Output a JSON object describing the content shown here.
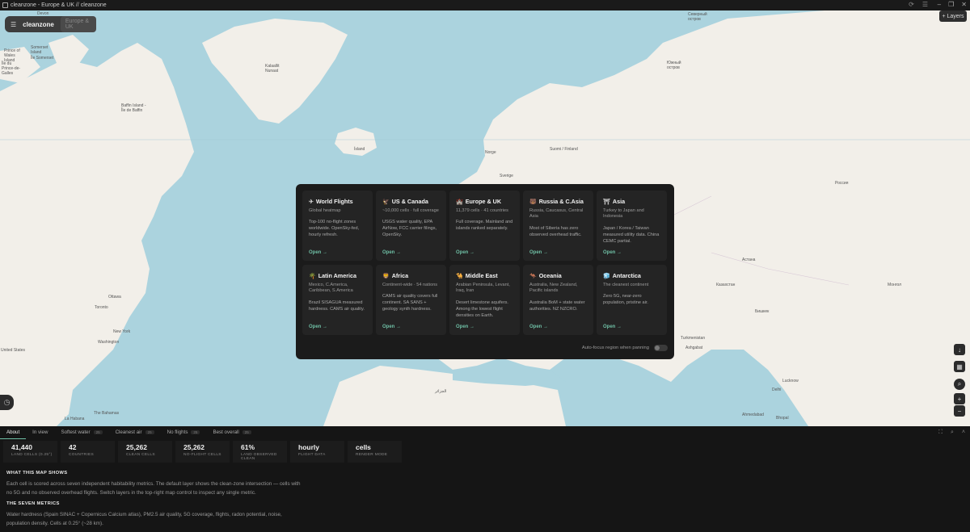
{
  "window": {
    "title": "cleanzone - Europe & UK // cleanzone"
  },
  "topbar": {
    "brand": "cleanzone",
    "region": "Europe & UK",
    "layers_label": "+ Layers"
  },
  "map_labels": [
    "Devon",
    "Prince of Wales Island",
    "Somerset Island",
    "Île du Prince-de-Galles",
    "Île Somerset",
    "Baffin Island - Île de Baffin",
    "Kalaallit Nunaat",
    "Ísland",
    "Norge",
    "Suomi / Finland",
    "Sverige",
    "Северный остров",
    "Южный остров",
    "Россия",
    "Астана",
    "Казахстан",
    "Монгол",
    "Бишкек",
    "Toronto",
    "Ottawa",
    "New York",
    "Washington",
    "United States",
    "The Bahamas",
    "La Habana",
    "Ashgabat",
    "Turkmenistan",
    "Delhi",
    "Lucknow",
    "Ahmedabad",
    "Bhopal",
    "الجزائر"
  ],
  "regions": [
    {
      "icon": "✈",
      "title": "World Flights",
      "sub": "Global heatmap",
      "desc": "Top-100 no-flight zones worldwide. OpenSky-fed, hourly refresh.",
      "open": "Open →"
    },
    {
      "icon": "🦅",
      "title": "US & Canada",
      "sub": "~10,000 cells · full coverage",
      "desc": "USGS water quality, EPA AirNow, FCC carrier filings, OpenSky.",
      "open": "Open →"
    },
    {
      "icon": "🏰",
      "title": "Europe & UK",
      "sub": "11,379 cells · 41 countries",
      "desc": "Full coverage. Mainland and islands ranked separately.",
      "open": "Open →"
    },
    {
      "icon": "🐻",
      "title": "Russia & C.Asia",
      "sub": "Russia, Caucasus, Central Asia",
      "desc": "Most of Siberia has zero observed overhead traffic.",
      "open": "Open →"
    },
    {
      "icon": "⛩",
      "title": "Asia",
      "sub": "Turkey to Japan and Indonesia",
      "desc": "Japan / Korea / Taiwan measured utility data. China CEMC partial.",
      "open": "Open →"
    },
    {
      "icon": "🌴",
      "title": "Latin America",
      "sub": "Mexico, C.America, Caribbean, S.America",
      "desc": "Brazil SISAGUA measured hardness. CAMS air quality.",
      "open": "Open →"
    },
    {
      "icon": "🦁",
      "title": "Africa",
      "sub": "Continent-wide · 54 nations",
      "desc": "CAMS air quality covers full continent. SA SANS + geology synth hardness.",
      "open": "Open →"
    },
    {
      "icon": "🐪",
      "title": "Middle East",
      "sub": "Arabian Peninsula, Levant, Iraq, Iran",
      "desc": "Desert limestone aquifers. Among the lowest flight densities on Earth.",
      "open": "Open →"
    },
    {
      "icon": "🦘",
      "title": "Oceania",
      "sub": "Australia, New Zealand, Pacific islands",
      "desc": "Australia BoM + state water authorities. NZ NZCRO.",
      "open": "Open →"
    },
    {
      "icon": "🧊",
      "title": "Antarctica",
      "sub": "The cleanest continent",
      "desc": "Zero 5G, near-zero population, pristine air.",
      "open": "Open →"
    }
  ],
  "autofocus_label": "Auto-focus region when panning",
  "tabs": [
    {
      "label": "About",
      "count": ""
    },
    {
      "label": "In view",
      "count": ""
    },
    {
      "label": "Softest water",
      "count": "25"
    },
    {
      "label": "Cleanest air",
      "count": "25"
    },
    {
      "label": "No flights",
      "count": "25"
    },
    {
      "label": "Best overall",
      "count": "25"
    }
  ],
  "stats": [
    {
      "value": "41,440",
      "label": "Land cells (0.25°)"
    },
    {
      "value": "42",
      "label": "Countries"
    },
    {
      "value": "25,262",
      "label": "Clean cells"
    },
    {
      "value": "25,262",
      "label": "No-flight cells"
    },
    {
      "value": "61%",
      "label": "Land observed clean"
    },
    {
      "value": "hourly",
      "label": "Flight data"
    },
    {
      "value": "cells",
      "label": "Render mode"
    }
  ],
  "about": {
    "section1_title": "WHAT THIS MAP SHOWS",
    "section1_body": "Each cell is scored across seven independent habitability metrics. The default layer shows the clean-zone intersection — cells with no 5G and no observed overhead flights. Switch layers in the top-right map control to inspect any single metric.",
    "section2_title": "THE SEVEN METRICS",
    "section2_body": "Water hardness (Spain SINAC + Copernicus Calcium atlas), PM2.5 air quality, 5G coverage, flights, radon potential, noise, population density. Cells at 0.25° (~28 km)."
  },
  "colors": {
    "accent": "#6fbfa5",
    "water": "#abd3de",
    "land": "#f2efe9",
    "panel": "#1b1b1b"
  }
}
